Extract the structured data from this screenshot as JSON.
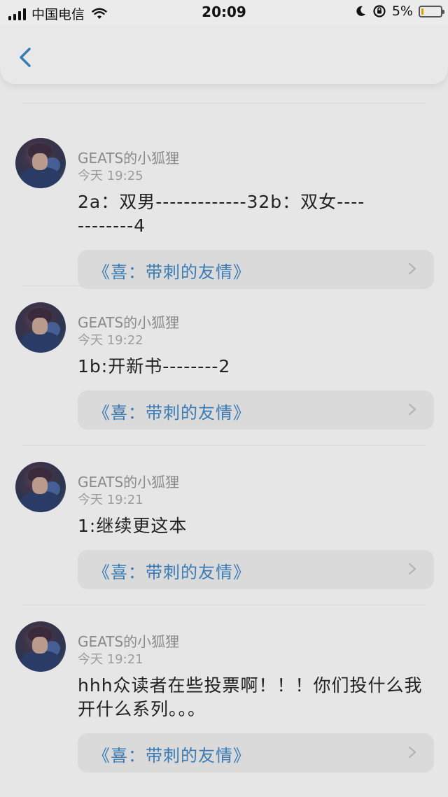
{
  "status_bar": {
    "carrier": "中国电信",
    "time": "20:09",
    "battery": "5%"
  },
  "posts": [
    {
      "author": "GEATS的小狐狸",
      "timestamp": "今天 19:25",
      "content": "2a：双男-------------32b：双女------------4",
      "book_link": "《喜：带刺的友情》"
    },
    {
      "author": "GEATS的小狐狸",
      "timestamp": "今天 19:22",
      "content": "1b:开新书--------2",
      "book_link": "《喜：带刺的友情》"
    },
    {
      "author": "GEATS的小狐狸",
      "timestamp": "今天 19:21",
      "content": "1:继续更这本",
      "book_link": "《喜：带刺的友情》"
    },
    {
      "author": "GEATS的小狐狸",
      "timestamp": "今天 19:21",
      "content": "hhh众读者在些投票啊！！！你们投什么我开什么系列。。。",
      "book_link": "《喜：带刺的友情》"
    }
  ]
}
